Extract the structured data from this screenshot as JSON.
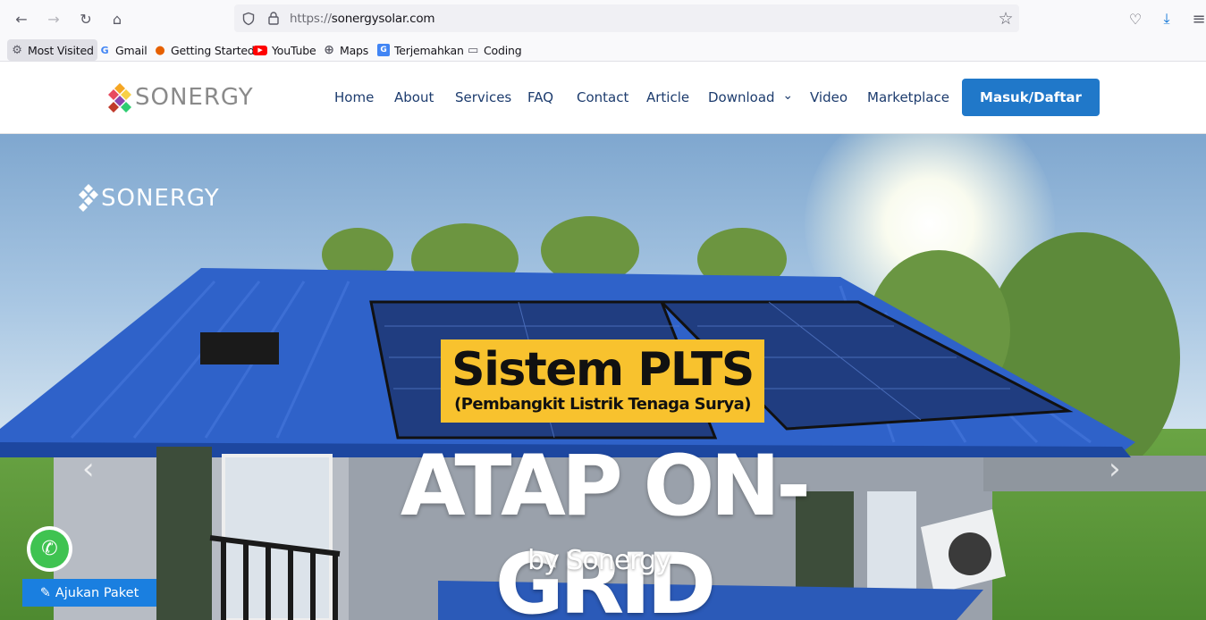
{
  "browser": {
    "url_scheme": "https://",
    "url_host": "sonergysolar.com",
    "back_icon": "←",
    "forward_icon": "→",
    "reload_icon": "↻",
    "home_icon": "⌂",
    "star_icon": "☆",
    "pocket_icon": "♡",
    "download_icon": "⤓",
    "menu_icon": "≡"
  },
  "bookmarks": [
    {
      "label": "Most Visited",
      "icon": "⚙"
    },
    {
      "label": "Gmail",
      "icon": "G"
    },
    {
      "label": "Getting Started",
      "icon": "●"
    },
    {
      "label": "YouTube",
      "icon": "▶"
    },
    {
      "label": "Maps",
      "icon": "⊕"
    },
    {
      "label": "Terjemahkan",
      "icon": "G"
    },
    {
      "label": "Coding",
      "icon": "▭"
    }
  ],
  "site": {
    "logo_text": "SONERGY",
    "nav": [
      "Home",
      "About",
      "Services",
      "FAQ",
      "Contact",
      "Article",
      "Download",
      "Video",
      "Marketplace"
    ],
    "dropdown_icon": "⌄",
    "cta_label": "Masuk/Daftar"
  },
  "hero": {
    "logo_text": "SONERGY",
    "title": "Sistem PLTS",
    "subtitle": "(Pembangkit Listrik Tenaga Surya)",
    "headline": "ATAP ON-GRID",
    "byline": "by Sonergy",
    "prev_icon": "‹",
    "next_icon": "›"
  },
  "floating": {
    "whatsapp_icon": "✆",
    "ajukan_label": "Ajukan Paket",
    "ajukan_icon": "✎"
  },
  "colors": {
    "nav_text": "#1d3c6e",
    "cta_bg": "#2078c9",
    "plts_box": "#f8c22e",
    "ajukan_bg": "#1a7fe0",
    "whatsapp": "#3fc351",
    "roof": "#2f62c9"
  }
}
